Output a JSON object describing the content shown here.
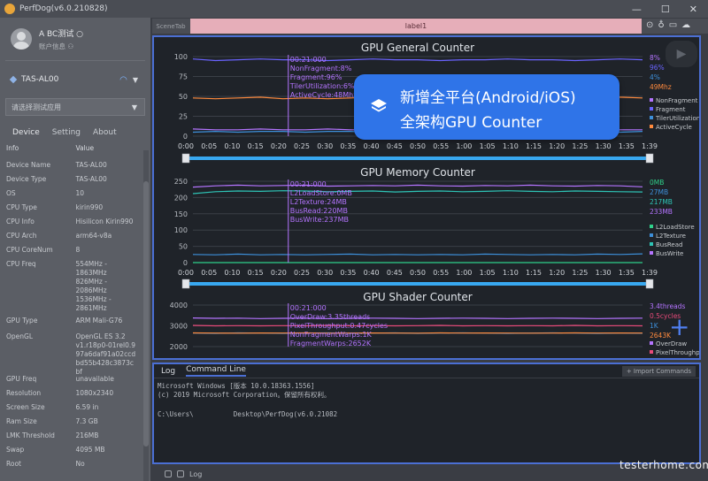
{
  "app": {
    "title": "PerfDog(v6.0.210828)"
  },
  "user": {
    "name": "A BC测试 ○",
    "sub": "账户信息 ⚇"
  },
  "device": {
    "name": "TAS-AL00"
  },
  "app_select": {
    "placeholder": "请选择测试应用"
  },
  "tabs": [
    "Device",
    "Setting",
    "About"
  ],
  "info": {
    "header": {
      "k": "Info",
      "v": "Value"
    },
    "rows": [
      {
        "k": "Device Name",
        "v": "TAS-AL00"
      },
      {
        "k": "Device Type",
        "v": "TAS-AL00"
      },
      {
        "k": "OS",
        "v": "10"
      },
      {
        "k": "CPU Type",
        "v": "kirin990"
      },
      {
        "k": "CPU Info",
        "v": "Hisilicon Kirin990"
      },
      {
        "k": "CPU Arch",
        "v": "arm64-v8a"
      },
      {
        "k": "CPU CoreNum",
        "v": "8"
      },
      {
        "k": "CPU Freq",
        "v": "554MHz -\n1863MHz\n826MHz -\n2086MHz\n1536MHz -\n2861MHz"
      },
      {
        "k": "GPU Type",
        "v": "ARM Mali-G76"
      },
      {
        "k": "OpenGL",
        "v": "OpenGL ES 3.2\nv1.r18p0-01rel0.9\n97a6daf91a02ccd\nbd55b428c3873c\nbf"
      },
      {
        "k": "GPU Freq",
        "v": "unavailable"
      },
      {
        "k": "Resolution",
        "v": "1080x2340"
      },
      {
        "k": "Screen Size",
        "v": "6.59 in"
      },
      {
        "k": "Ram Size",
        "v": "7.3 GB"
      },
      {
        "k": "LMK Threshold",
        "v": "216MB"
      },
      {
        "k": "Swap",
        "v": "4095 MB"
      },
      {
        "k": "Root",
        "v": "No"
      }
    ]
  },
  "scene": {
    "tab": "SceneTab",
    "label": "label1"
  },
  "promo": {
    "line1": "新增全平台(Android/iOS)",
    "line2": "全架构GPU Counter"
  },
  "log": {
    "tabs": [
      "Log",
      "Command Line"
    ],
    "import_label": "+ Import Commands",
    "lines": [
      "Microsoft Windows [版本 10.0.18363.1556]",
      "(c) 2019 Microsoft Corporation。保留所有权利。"
    ],
    "prompt": "C:\\Users\\          Desktop\\PerfDog(v6.0.21082"
  },
  "statusbar": {
    "label": "Log"
  },
  "watermark": "testerhome.com",
  "chart_data": [
    {
      "type": "line",
      "title": "GPU General Counter",
      "ylim": [
        0,
        100
      ],
      "yticks": [
        0,
        25,
        50,
        75,
        100
      ],
      "x_labels": [
        "0:00",
        "0:05",
        "0:10",
        "0:15",
        "0:20",
        "0:25",
        "0:30",
        "0:35",
        "0:40",
        "0:45",
        "0:50",
        "0:55",
        "1:00",
        "1:05",
        "1:10",
        "1:15",
        "1:20",
        "1:25",
        "1:30",
        "1:35",
        "1:39"
      ],
      "tooltip": {
        "time": "00:21:000",
        "lines": [
          "NonFragment:8%",
          "Fragment:96%",
          "TilerUtilization:6%",
          "ActiveCycle:48Mhz"
        ]
      },
      "legend_values": [
        "8%",
        "96%",
        "4%",
        "49Mhz"
      ],
      "series": [
        {
          "name": "NonFragment",
          "color": "#b474ff",
          "values": [
            9,
            8,
            8,
            9,
            8,
            8,
            9,
            8,
            8,
            8,
            9,
            8,
            8,
            8,
            9,
            8,
            8,
            9,
            8,
            8,
            8
          ]
        },
        {
          "name": "Fragment",
          "color": "#6a63ff",
          "values": [
            97,
            95,
            96,
            97,
            96,
            96,
            95,
            96,
            97,
            96,
            96,
            95,
            96,
            96,
            97,
            96,
            96,
            95,
            96,
            97,
            96
          ]
        },
        {
          "name": "TilerUtilization",
          "color": "#3d8fd9",
          "values": [
            5,
            6,
            5,
            6,
            6,
            5,
            6,
            6,
            5,
            6,
            6,
            5,
            6,
            5,
            6,
            6,
            5,
            6,
            6,
            5,
            6
          ]
        },
        {
          "name": "ActiveCycle",
          "color": "#ff8a3d",
          "values": [
            48,
            47,
            48,
            49,
            47,
            48,
            47,
            48,
            49,
            48,
            47,
            48,
            49,
            48,
            47,
            48,
            49,
            47,
            48,
            49,
            48
          ]
        }
      ]
    },
    {
      "type": "line",
      "title": "GPU Memory Counter",
      "ylim": [
        0,
        250
      ],
      "yticks": [
        0,
        50,
        100,
        150,
        200,
        250
      ],
      "x_labels": [
        "0:00",
        "0:05",
        "0:10",
        "0:15",
        "0:20",
        "0:25",
        "0:30",
        "0:35",
        "0:40",
        "0:45",
        "0:50",
        "0:55",
        "1:00",
        "1:05",
        "1:10",
        "1:15",
        "1:20",
        "1:25",
        "1:30",
        "1:35",
        "1:39"
      ],
      "tooltip": {
        "time": "00:21:000",
        "lines": [
          "L2LoadStore:0MB",
          "L2Texture:24MB",
          "BusRead:220MB",
          "BusWrite:237MB"
        ]
      },
      "legend_values": [
        "0MB",
        "27MB",
        "217MB",
        "233MB"
      ],
      "series": [
        {
          "name": "L2LoadStore",
          "color": "#2fd08a",
          "values": [
            0,
            0,
            0,
            0,
            0,
            0,
            0,
            0,
            0,
            0,
            0,
            0,
            0,
            0,
            0,
            0,
            0,
            0,
            0,
            0,
            0
          ]
        },
        {
          "name": "L2Texture",
          "color": "#3d8fd9",
          "values": [
            25,
            24,
            26,
            24,
            25,
            24,
            25,
            26,
            24,
            25,
            24,
            25,
            24,
            26,
            25,
            24,
            25,
            24,
            26,
            25,
            27
          ]
        },
        {
          "name": "BusRead",
          "color": "#2ec4b6",
          "values": [
            212,
            218,
            220,
            219,
            221,
            220,
            218,
            219,
            220,
            217,
            219,
            220,
            218,
            219,
            221,
            219,
            218,
            220,
            219,
            218,
            217
          ]
        },
        {
          "name": "BusWrite",
          "color": "#b474ff",
          "values": [
            232,
            236,
            238,
            236,
            237,
            238,
            235,
            236,
            237,
            236,
            238,
            236,
            235,
            237,
            236,
            238,
            236,
            235,
            237,
            236,
            233
          ]
        }
      ]
    },
    {
      "type": "line",
      "title": "GPU Shader Counter",
      "ylim": [
        2000,
        4000
      ],
      "yticks": [
        2000,
        3000,
        4000
      ],
      "tooltip": {
        "time": "00:21:000",
        "lines": [
          "OverDraw:3.35threads",
          "PixelThroughput:0.47cycles",
          "NonFragmentWarps:1K",
          "FragmentWarps:2652K"
        ]
      },
      "legend_values": [
        "3.4threads",
        "0.5cycles",
        "1K",
        "2643K"
      ],
      "legend_names": [
        "OverDraw",
        "PixelThroughput"
      ],
      "series": [
        {
          "name": "OverDraw",
          "color": "#b474ff",
          "values": [
            3380,
            3360,
            3370,
            3350,
            3360,
            3370,
            3350,
            3360,
            3370,
            3360,
            3350,
            3360,
            3370,
            3360,
            3350,
            3360,
            3370,
            3360,
            3350,
            3360,
            3370
          ]
        },
        {
          "name": "PixelThroughput",
          "color": "#e84a7a",
          "values": [
            3020,
            3000,
            3010,
            3000,
            3010,
            3000,
            3020,
            3000,
            3010,
            3000,
            3010,
            3020,
            3000,
            3010,
            3000,
            3010,
            3000,
            3020,
            3000,
            3010,
            3000
          ]
        },
        {
          "name": "NonFragmentWarps",
          "color": "#3d8fd9",
          "values": [
            2650,
            2640,
            2660,
            2650,
            2640,
            2650,
            2660,
            2640,
            2650,
            2660,
            2640,
            2650,
            2660,
            2650,
            2640,
            2650,
            2660,
            2650,
            2640,
            2650,
            2643
          ]
        },
        {
          "name": "FragmentWarps",
          "color": "#ff8a3d",
          "values": [
            2660,
            2650,
            2645,
            2655,
            2650,
            2660,
            2645,
            2650,
            2655,
            2650,
            2645,
            2660,
            2650,
            2655,
            2650,
            2645,
            2650,
            2660,
            2650,
            2655,
            2650
          ]
        }
      ]
    }
  ]
}
